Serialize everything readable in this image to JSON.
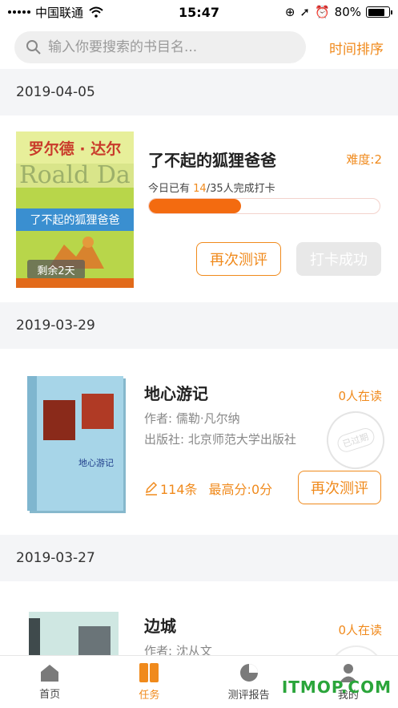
{
  "status_bar": {
    "carrier": "中国联通",
    "time": "15:47",
    "battery": "80%"
  },
  "search": {
    "placeholder": "输入你要搜索的书目名...",
    "sort_label": "时间排序"
  },
  "groups": [
    {
      "date": "2019-04-05",
      "book": {
        "title": "了不起的狐狸爸爸",
        "difficulty": "难度:2",
        "progress_prefix": "今日已有 ",
        "progress_done": "14",
        "progress_suffix": "/35人完成打卡",
        "progress_fraction": 0.4,
        "cover_top_text": "罗尔德 · 达尔",
        "cover_title": "了不起的狐狸爸爸",
        "remaining": "剩余2天",
        "retest_label": "再次测评",
        "checkin_label": "打卡成功"
      }
    },
    {
      "date": "2019-03-29",
      "book": {
        "title": "地心游记",
        "readers": "0人在读",
        "author": "作者: 儒勒·凡尔纳",
        "publisher": "出版社: 北京师范大学出版社",
        "notes_count": "114条",
        "high_score": "最高分:0分",
        "retest_label": "再次测评",
        "expired_stamp": "已过期",
        "cover_title": "地心游记"
      }
    },
    {
      "date": "2019-03-27",
      "book": {
        "title": "边城",
        "readers": "0人在读",
        "author": "作者: 沈从文"
      }
    }
  ],
  "tabbar": [
    {
      "label": "首页",
      "icon": "home-icon"
    },
    {
      "label": "任务",
      "icon": "task-icon",
      "active": true
    },
    {
      "label": "测评报告",
      "icon": "report-icon"
    },
    {
      "label": "我的",
      "icon": "profile-icon"
    }
  ],
  "watermark": "ITMOP.COM",
  "colors": {
    "accent": "#f08a1c",
    "progress": "#f36b10",
    "band": "#f4f5f7"
  }
}
